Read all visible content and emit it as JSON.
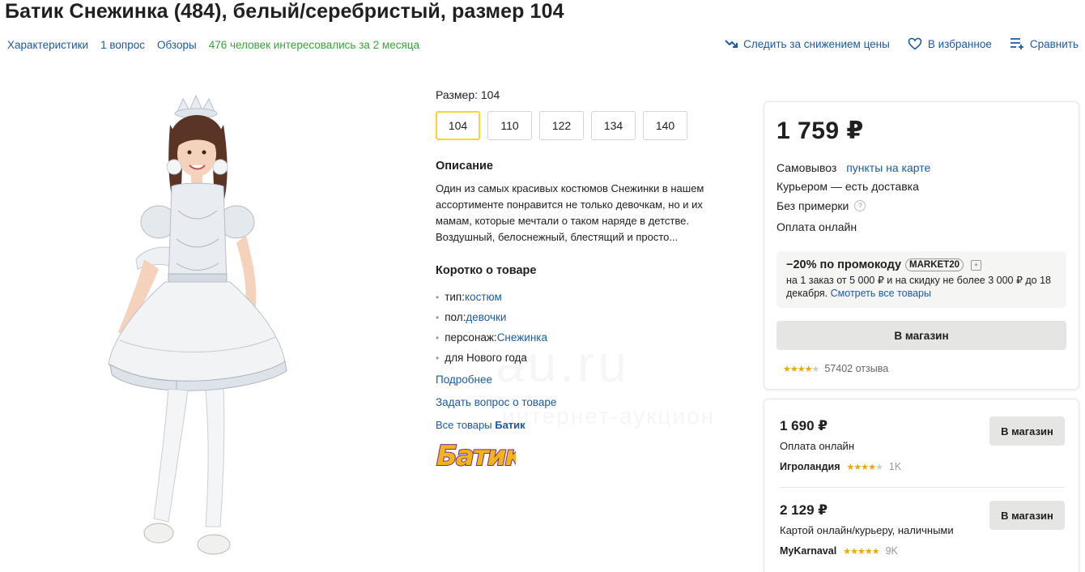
{
  "title": "Батик Снежинка (484), белый/серебристый, размер 104",
  "subnav": {
    "characteristics": "Характеристики",
    "questions": "1 вопрос",
    "reviews": "Обзоры",
    "interest": "476 человек интересовались за 2 месяца"
  },
  "actions": {
    "track_price": "Следить за снижением цены",
    "favorite": "В избранное",
    "compare": "Сравнить"
  },
  "size": {
    "label": "Размер: 104",
    "options": [
      "104",
      "110",
      "122",
      "134",
      "140"
    ],
    "selected": "104"
  },
  "description": {
    "heading": "Описание",
    "text": "Один из самых красивых костюмов Снежинки в нашем ассортименте понравится не только девочкам, но и их мамам, которые мечтали о таком наряде в детстве. Воздушный, белоснежный, блестящий и просто..."
  },
  "short": {
    "heading": "Коротко о товаре",
    "items": [
      {
        "key": "тип: ",
        "value": "костюм",
        "linked": true
      },
      {
        "key": "пол: ",
        "value": "девочки",
        "linked": true
      },
      {
        "key": "персонаж: ",
        "value": "Снежинка",
        "linked": true
      },
      {
        "key": "для Нового года",
        "value": "",
        "linked": false
      }
    ]
  },
  "links": {
    "more": "Подробнее",
    "ask": "Задать вопрос о товаре",
    "all_prefix": "Все товары ",
    "all_brand": "Батик",
    "brand_logo": "Батик"
  },
  "watermark": {
    "main": "au.ru",
    "sub": "интернет-аукцион"
  },
  "main_offer": {
    "price": "1 759 ₽",
    "pickup_prefix": "Самовывоз ",
    "pickup_link": "пункты на карте",
    "courier": "Курьером — есть доставка",
    "fitting": "Без примерки",
    "payment": "Оплата онлайн",
    "promo_title": "−20% по промокоду",
    "promo_code": "MARKET20",
    "promo_text": "на 1 заказ от 5 000 ₽ и на скидку не более 3 000 ₽ до 18 декабря. ",
    "promo_link": "Смотреть все товары",
    "button": "В магазин",
    "rating": 4,
    "reviews": "57402 отзыва"
  },
  "offers": [
    {
      "price": "1 690 ₽",
      "payment": "Оплата онлайн",
      "shop": "Игроландия",
      "rating": 4,
      "count": "1K",
      "button": "В магазин"
    },
    {
      "price": "2 129 ₽",
      "payment": "Картой онлайн/курьеру, наличными",
      "shop": "MyKarnaval",
      "rating": 5,
      "count": "9K",
      "button": "В магазин"
    }
  ],
  "colors": {
    "link": "#1a5ba6",
    "interest": "#34a836",
    "selected_border": "#fed42b",
    "star": "#f0a500",
    "button_bg": "#e5e5e4"
  }
}
